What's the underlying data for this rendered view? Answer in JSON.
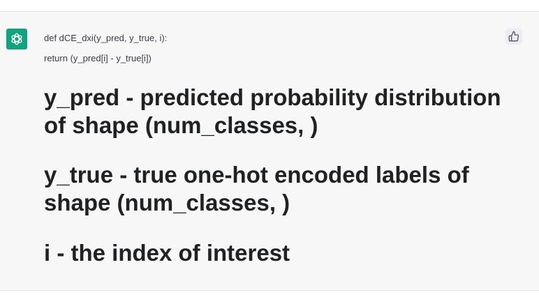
{
  "message": {
    "avatar_icon": "openai-logo-icon",
    "avatar_color": "#10a37f",
    "code_lines": [
      "def dCE_dxi(y_pred, y_true, i):",
      "return (y_pred[i] - y_true[i])"
    ],
    "paragraphs": [
      "y_pred - predicted probability distribution of shape (num_classes, )",
      "y_true - true one-hot encoded labels of shape (num_classes, )",
      "i - the index of interest"
    ],
    "feedback_icon": "thumbs-up-icon"
  }
}
